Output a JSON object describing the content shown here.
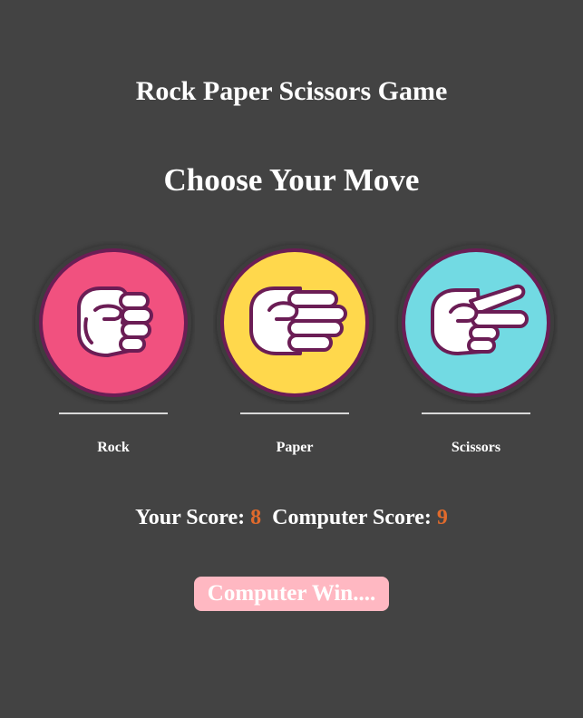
{
  "title": "Rock Paper Scissors Game",
  "prompt": "Choose Your Move",
  "choices": [
    {
      "label": "Rock",
      "icon": "rock-hand-icon",
      "color": "#f1517f"
    },
    {
      "label": "Paper",
      "icon": "paper-hand-icon",
      "color": "#ffd84c"
    },
    {
      "label": "Scissors",
      "icon": "scissors-hand-icon",
      "color": "#72dae3"
    }
  ],
  "score": {
    "your_label": "Your Score:",
    "your_value": "8",
    "computer_label": "Computer Score:",
    "computer_value": "9"
  },
  "result": "Computer Win....",
  "colors": {
    "background": "#434343",
    "outline": "#6b1d55",
    "score_accent": "#e06a2c",
    "result_bg": "#ffb8c2"
  }
}
